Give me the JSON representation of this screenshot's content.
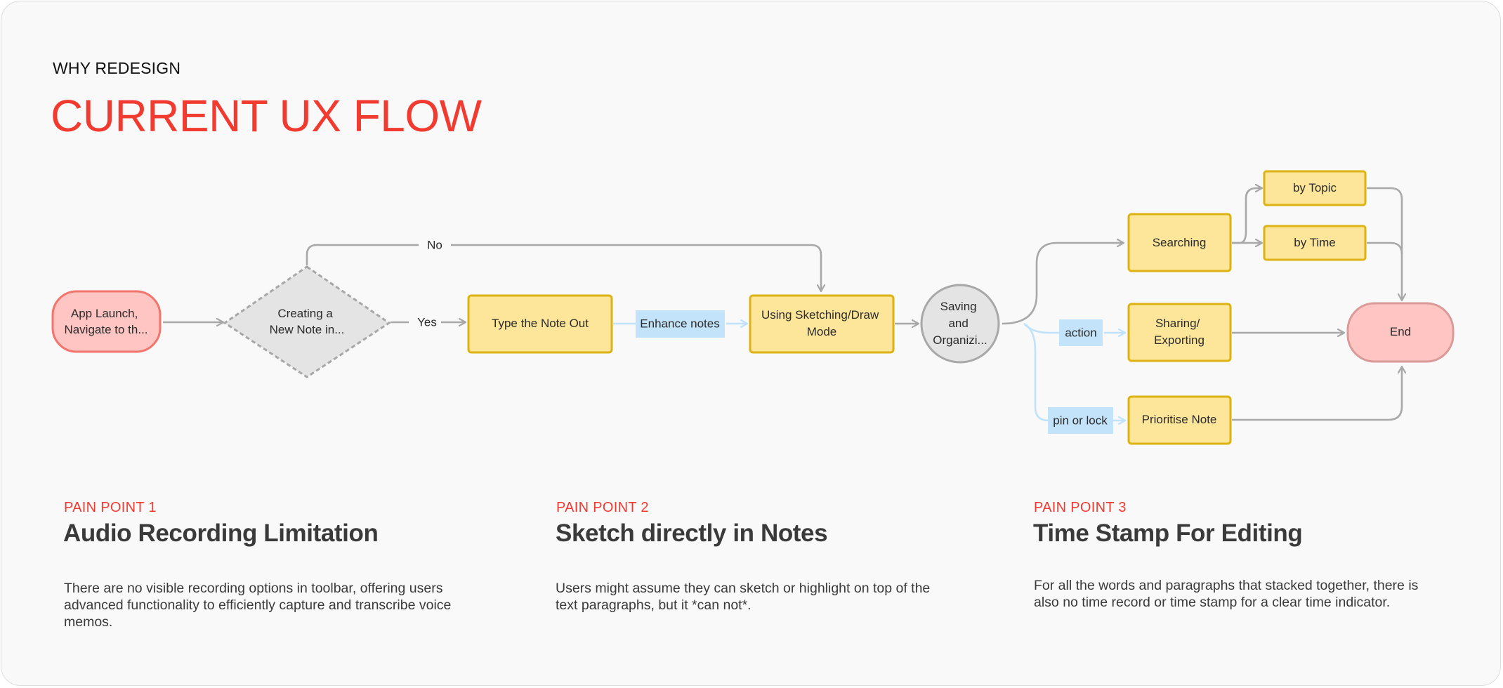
{
  "header": {
    "eyebrow": "WHY REDESIGN",
    "title": "CURRENT UX FLOW"
  },
  "colors": {
    "accent_red": "#f23b30",
    "start_end_fill": "#ffc5c3",
    "start_border": "#f2746c",
    "end_border": "#d99a98",
    "process_fill": "#fde699",
    "process_border": "#dcb312",
    "decision_fill": "#e4e4e4",
    "label_fill": "#c3e3fb",
    "connector": "#a8a8a8",
    "connector_light": "#c0e2fa"
  },
  "flow": {
    "start": {
      "lines": [
        "App Launch,",
        "Navigate to th..."
      ]
    },
    "decision": {
      "lines": [
        "Creating a",
        "New Note in..."
      ]
    },
    "edge_no": "No",
    "edge_yes": "Yes",
    "type_note": {
      "lines": [
        "Type the Note Out"
      ]
    },
    "enhance_label": "Enhance notes",
    "sketch_mode": {
      "lines": [
        "Using Sketching/Draw",
        "Mode"
      ]
    },
    "saving": {
      "lines": [
        "Saving",
        "and",
        "Organizi..."
      ]
    },
    "searching": {
      "lines": [
        "Searching"
      ]
    },
    "by_topic": {
      "lines": [
        "by Topic"
      ]
    },
    "by_time": {
      "lines": [
        "by Time"
      ]
    },
    "action_label": "action",
    "sharing": {
      "lines": [
        "Sharing/",
        "Exporting"
      ]
    },
    "pin_label": "pin or lock",
    "prioritise": {
      "lines": [
        "Prioritise Note"
      ]
    },
    "end": {
      "lines": [
        "End"
      ]
    }
  },
  "pain_points": [
    {
      "label": "PAIN POINT 1",
      "title": "Audio Recording Limitation",
      "lines": [
        "There are no visible recording options in toolbar, offering users",
        "advanced functionality to efficiently capture and transcribe voice",
        "memos."
      ]
    },
    {
      "label": "PAIN POINT 2",
      "title": "Sketch directly in Notes",
      "lines": [
        "Users might assume they can sketch or highlight on top of the",
        "text paragraphs, but it *can not*."
      ]
    },
    {
      "label": "PAIN POINT 3",
      "title": "Time Stamp For Editing",
      "lines": [
        "For all the words and paragraphs that stacked together, there is",
        "also no time record or time stamp for a clear time indicator."
      ]
    }
  ]
}
